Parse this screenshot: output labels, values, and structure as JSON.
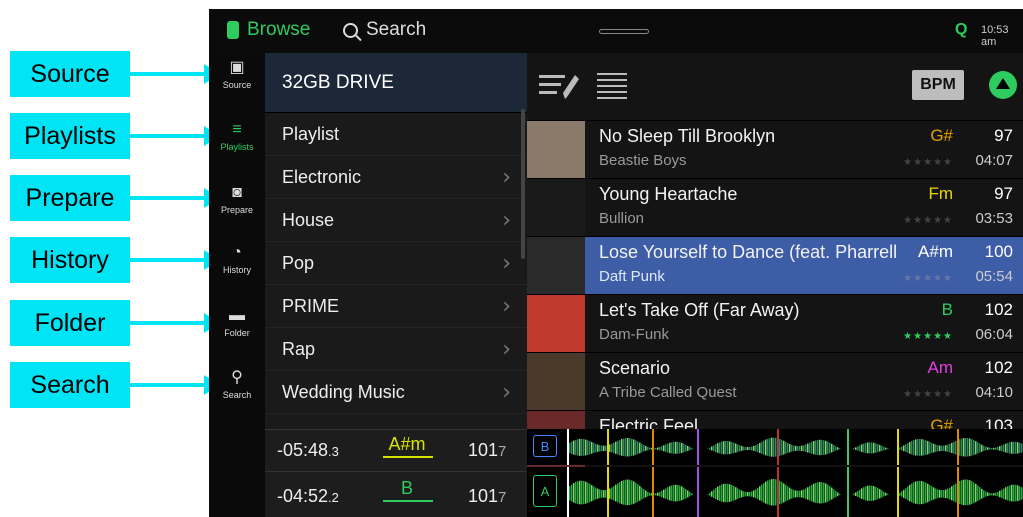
{
  "callouts": [
    "Source",
    "Playlists",
    "Prepare",
    "History",
    "Folder",
    "Search"
  ],
  "topbar": {
    "browse_label": "Browse",
    "search_label": "Search",
    "clock": "10:53 am",
    "status_letter": "Q"
  },
  "rail": [
    {
      "label": "Source",
      "glyph": "▣",
      "active": false
    },
    {
      "label": "Playlists",
      "glyph": "≡",
      "active": true
    },
    {
      "label": "Prepare",
      "glyph": "◙",
      "active": false
    },
    {
      "label": "History",
      "glyph": "◔",
      "active": false
    },
    {
      "label": "Folder",
      "glyph": "▬",
      "active": false
    },
    {
      "label": "Search",
      "glyph": "⚲",
      "active": false
    }
  ],
  "folders": {
    "drive": "32GB DRIVE",
    "items": [
      {
        "label": "Playlist",
        "chevron": false
      },
      {
        "label": "Electronic",
        "chevron": true
      },
      {
        "label": "House",
        "chevron": true
      },
      {
        "label": "Pop",
        "chevron": true
      },
      {
        "label": "PRIME",
        "chevron": true
      },
      {
        "label": "Rap",
        "chevron": true
      },
      {
        "label": "Wedding Music",
        "chevron": true
      }
    ]
  },
  "decks": [
    {
      "time": "-05:48",
      "tenths": ".3",
      "key": "A#m",
      "key_color": "#d8e400",
      "bpm": "101",
      "bpm_dec": "7"
    },
    {
      "time": "-04:52",
      "tenths": ".2",
      "key": "B",
      "key_color": "#2ecc5f",
      "bpm": "101",
      "bpm_dec": "7"
    }
  ],
  "toolbar": {
    "bpm_label": "BPM"
  },
  "tracks": [
    {
      "title": "No Sleep Till Brooklyn",
      "artist": "Beastie Boys",
      "key": "G#",
      "key_color": "#e0a000",
      "bpm": "97",
      "duration": "04:07",
      "rating": 0,
      "selected": false,
      "art_color": "#8a7a6a"
    },
    {
      "title": "Young Heartache",
      "artist": "Bullion",
      "key": "Fm",
      "key_color": "#e8d800",
      "bpm": "97",
      "duration": "03:53",
      "rating": 0,
      "selected": false,
      "art_color": "#1a1a1a"
    },
    {
      "title": "Lose Yourself to Dance (feat. Pharrell",
      "artist": "Daft Punk",
      "key": "A#m",
      "key_color": "#ffffff",
      "bpm": "100",
      "duration": "05:54",
      "rating": 0,
      "selected": true,
      "art_color": "#2a2a2a"
    },
    {
      "title": "Let's Take Off (Far Away)",
      "artist": "Dam-Funk",
      "key": "B",
      "key_color": "#2ecc5f",
      "bpm": "102",
      "duration": "06:04",
      "rating": 5,
      "selected": false,
      "art_color": "#c0392b"
    },
    {
      "title": "Scenario",
      "artist": "A Tribe Called Quest",
      "key": "Am",
      "key_color": "#e040e0",
      "bpm": "102",
      "duration": "04:10",
      "rating": 0,
      "selected": false,
      "art_color": "#4a3a2a"
    },
    {
      "title": "Electric Feel",
      "artist": "",
      "key": "G#",
      "key_color": "#e0a000",
      "bpm": "103",
      "duration": "",
      "rating": 0,
      "selected": false,
      "art_color": "#6a2a2a"
    }
  ],
  "waves": [
    {
      "deck": "B",
      "color": "#3b8cff"
    },
    {
      "deck": "A",
      "color": "#2ecc5f"
    }
  ]
}
